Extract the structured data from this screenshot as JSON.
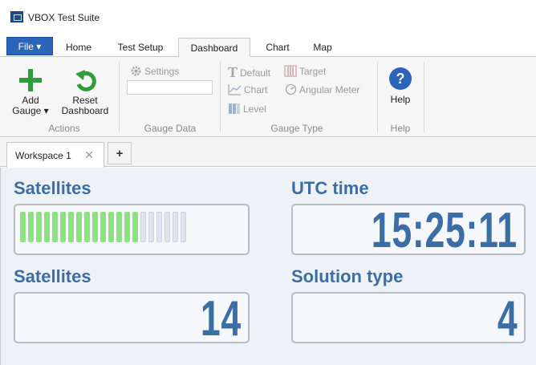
{
  "window": {
    "title": "VBOX Test Suite"
  },
  "ribbon_tabs": {
    "file": "File ▾",
    "home": "Home",
    "test_setup": "Test Setup",
    "dashboard": "Dashboard",
    "chart": "Chart",
    "map": "Map",
    "active": "Dashboard"
  },
  "actions": {
    "add_gauge_line1": "Add",
    "add_gauge_line2": "Gauge ▾",
    "reset_dashboard_line1": "Reset",
    "reset_dashboard_line2": "Dashboard",
    "group_label": "Actions"
  },
  "gauge_data": {
    "settings": "Settings",
    "group_label": "Gauge Data"
  },
  "gauge_type": {
    "default": "Default",
    "target": "Target",
    "chart": "Chart",
    "angular_meter": "Angular Meter",
    "level": "Level",
    "group_label": "Gauge Type"
  },
  "help": {
    "help_label": "Help",
    "group_label": "Help"
  },
  "workspace_tabs": {
    "tab1": "Workspace 1",
    "close": "✕",
    "add": "+"
  },
  "gauges": {
    "satellites_bar": {
      "label": "Satellites",
      "on_count": 15,
      "total": 21
    },
    "utc_time": {
      "label": "UTC time",
      "value": "15:25:11"
    },
    "satellites": {
      "label": "Satellites",
      "value": "14"
    },
    "solution_type": {
      "label": "Solution type",
      "value": "4"
    }
  },
  "colors": {
    "accent": "#3a6ea5",
    "file_button": "#2b64b8",
    "bar_on": "#8be37f",
    "bar_off": "#dfe4ee",
    "add_icon": "#2f9e3a"
  }
}
